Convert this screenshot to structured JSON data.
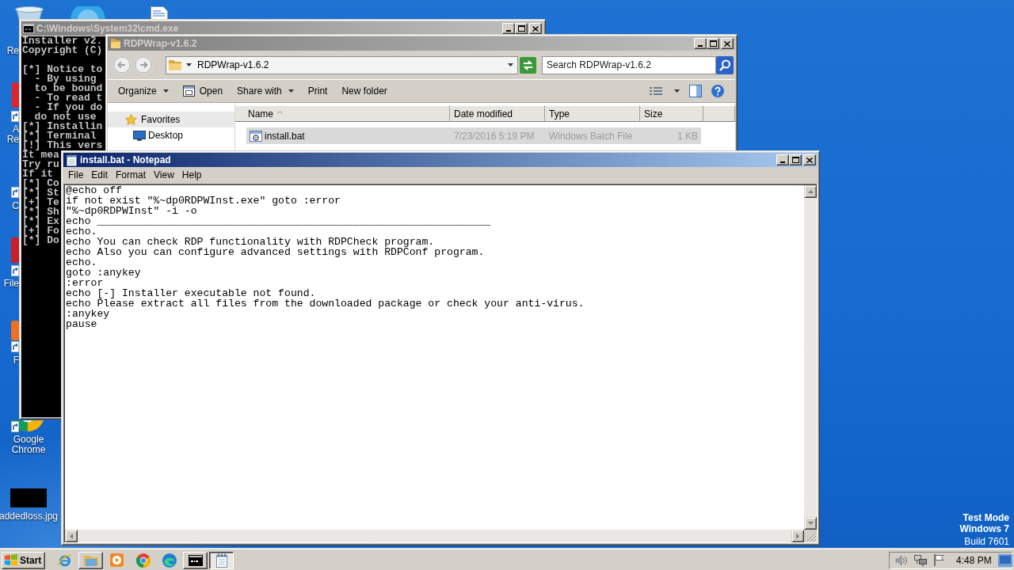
{
  "desktop": {
    "icons": [
      {
        "label_lines": [
          "Re"
        ]
      },
      {
        "label_lines": [
          "A",
          "Re"
        ]
      },
      {
        "label_lines": [
          "C"
        ]
      },
      {
        "label_lines": [
          "File"
        ]
      },
      {
        "label_lines": [
          "F"
        ]
      },
      {
        "label_lines": [
          "Google",
          "Chrome"
        ]
      },
      {
        "label_lines": [
          "addedloss.jpg"
        ]
      }
    ],
    "notice": [
      "Test Mode",
      "Windows 7",
      "Build 7601"
    ]
  },
  "cmd_window": {
    "title": "C:\\Windows\\System32\\cmd.exe",
    "active": false,
    "blocks": [
      [
        "Installer v2.",
        "Copyright (C)"
      ],
      [
        "[*] Notice to",
        "  - By using",
        "  to be bound",
        "  - To read t",
        "  - If you do",
        "  do not use",
        "[*] Installin",
        "[*] Terminal",
        "[!] This vers",
        "It mea",
        "Try ru",
        "If it",
        "[*] Co",
        "[*] St",
        "[+] Te",
        "[*] Sh",
        "[*] Ex",
        "[+] Fo",
        "[*] Do"
      ]
    ]
  },
  "explorer_window": {
    "title": "RDPWrap-v1.6.2",
    "active": false,
    "address": "RDPWrap-v1.6.2",
    "search": {
      "placeholder": "Search RDPWrap-v1.6.2"
    },
    "toolbar": [
      {
        "label": "Organize",
        "kind": "menu"
      },
      {
        "label": "Open",
        "kind": "icon"
      },
      {
        "label": "Share with",
        "kind": "menu"
      },
      {
        "label": "Print",
        "kind": "plain"
      },
      {
        "label": "New folder",
        "kind": "plain"
      }
    ],
    "nav": [
      {
        "label": "Favorites",
        "kind": "group"
      },
      {
        "label": "Desktop",
        "kind": "item"
      }
    ],
    "columns": [
      {
        "label": "Name",
        "sorted": true
      },
      {
        "label": "Date modified",
        "sorted": false
      },
      {
        "label": "Type",
        "sorted": false
      },
      {
        "label": "Size",
        "sorted": false
      }
    ],
    "rows": [
      {
        "name": "install.bat",
        "date_modified": "7/23/2016 5:19 PM",
        "type": "Windows Batch File",
        "size": "1 KB",
        "selected": true
      }
    ]
  },
  "notepad_window": {
    "title": "install.bat - Notepad",
    "active": true,
    "menu": [
      "File",
      "Edit",
      "Format",
      "View",
      "Help"
    ],
    "lines": [
      "@echo off",
      "if not exist \"%~dp0RDPWInst.exe\" goto :error",
      "\"%~dp0RDPWInst\" -i -o",
      "echo _______________________________________________________________",
      "echo.",
      "echo You can check RDP functionality with RDPCheck program.",
      "echo Also you can configure advanced settings with RDPConf program.",
      "echo.",
      "goto :anykey",
      ":error",
      "echo [-] Installer executable not found.",
      "echo Please extract all files from the downloaded package or check your anti-virus.",
      ":anykey",
      "pause"
    ]
  },
  "taskbar": {
    "start": "Start",
    "items": [
      {
        "kind": "pinned",
        "selected": false
      },
      {
        "kind": "window",
        "selected": false
      },
      {
        "kind": "pinned",
        "selected": false
      },
      {
        "kind": "pinned",
        "selected": false
      },
      {
        "kind": "pinned",
        "selected": false
      },
      {
        "kind": "window",
        "selected": false
      },
      {
        "kind": "window",
        "selected": true
      }
    ],
    "clock": "4:48 PM"
  }
}
